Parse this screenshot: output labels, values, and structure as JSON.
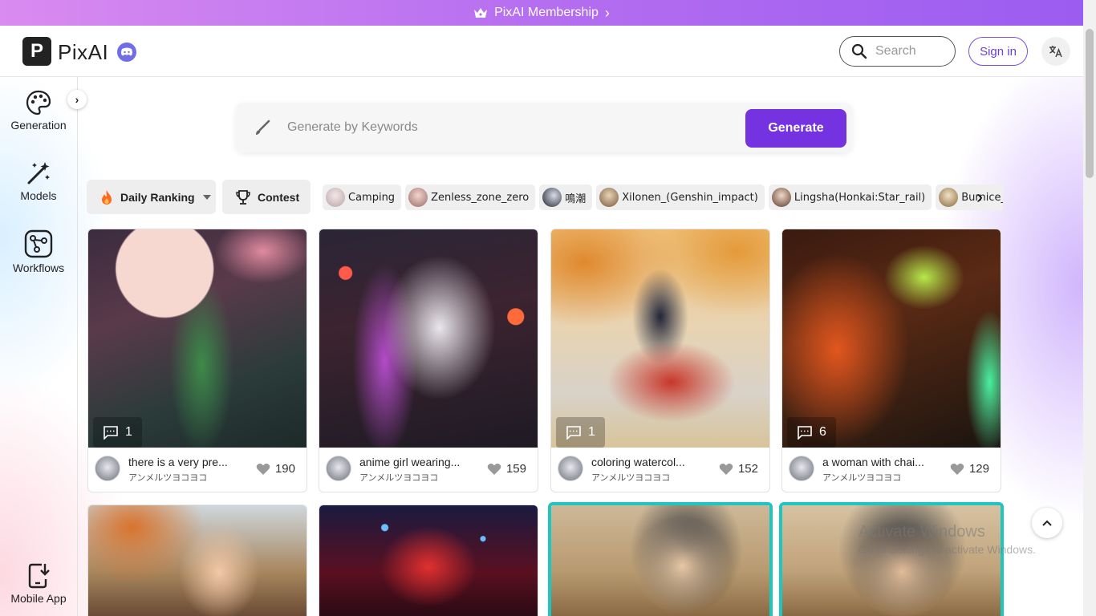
{
  "banner": {
    "label": "PixAI Membership"
  },
  "header": {
    "logo_letter": "P",
    "app_name": "PixAI",
    "search_placeholder": "Search",
    "sign_in": "Sign in"
  },
  "sidebar": {
    "items": [
      {
        "label": "Generation",
        "icon": "palette-icon"
      },
      {
        "label": "Models",
        "icon": "magic-wand-icon"
      },
      {
        "label": "Workflows",
        "icon": "workflow-icon"
      },
      {
        "label": "Mobile App",
        "icon": "phone-download-icon"
      }
    ]
  },
  "generate": {
    "placeholder": "Generate by Keywords",
    "button": "Generate"
  },
  "filters": {
    "ranking": "Daily Ranking",
    "contest": "Contest"
  },
  "tags": [
    "Camping",
    "Zenless_zone_zero",
    "鳴潮",
    "Xilonen_(Genshin_impact)",
    "Lingsha(Honkai:Star_rail)",
    "Burnice_white"
  ],
  "cards": [
    {
      "title": "there is a very pre...",
      "author": "アンメルツヨコヨコ",
      "likes": "190",
      "comments": "1"
    },
    {
      "title": "anime girl wearing...",
      "author": "アンメルツヨコヨコ",
      "likes": "159",
      "comments": ""
    },
    {
      "title": "coloring watercol...",
      "author": "アンメルツヨコヨコ",
      "likes": "152",
      "comments": "1"
    },
    {
      "title": "a woman with chai...",
      "author": "アンメルツヨコヨコ",
      "likes": "129",
      "comments": "6"
    }
  ],
  "watermark": {
    "line1": "Activate Windows",
    "line2": "Go to Settings to activate Windows."
  },
  "colors": {
    "accent": "#7432e0",
    "banner_start": "#d98bf0",
    "banner_end": "#9b5cf0",
    "highlight_border": "#1ec6c0"
  }
}
